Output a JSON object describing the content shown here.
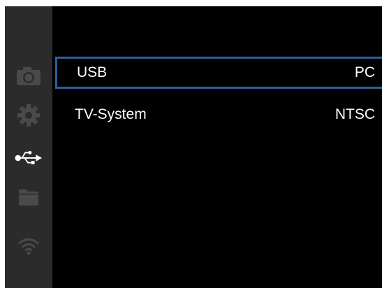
{
  "sidebar": {
    "items": [
      {
        "icon": "camera-icon",
        "active": false
      },
      {
        "icon": "gear-icon",
        "active": false
      },
      {
        "icon": "usb-icon",
        "active": true
      },
      {
        "icon": "folder-icon",
        "active": false
      },
      {
        "icon": "wifi-icon",
        "active": false
      }
    ]
  },
  "menu": {
    "items": [
      {
        "label": "USB",
        "value": "PC",
        "selected": true
      },
      {
        "label": "TV-System",
        "value": "NTSC",
        "selected": false
      }
    ]
  },
  "colors": {
    "background": "#000000",
    "sidebar": "#2b2b2b",
    "inactive_icon": "#4a4a4a",
    "active_icon": "#ffffff",
    "selection_border": "#2d5f9a",
    "text": "#ffffff"
  }
}
